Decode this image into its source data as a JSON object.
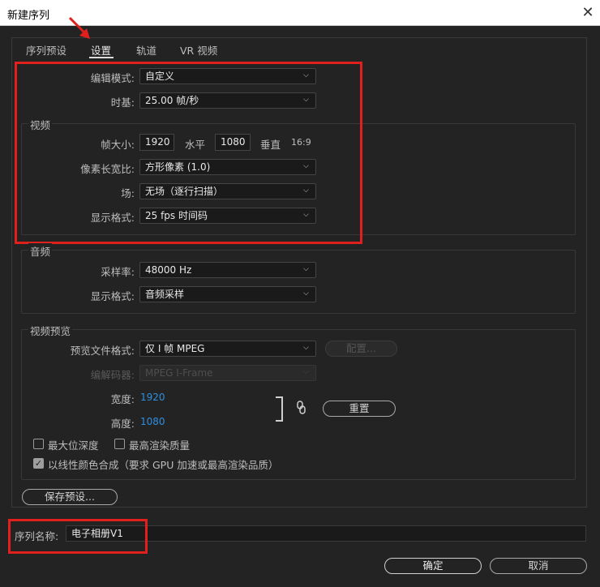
{
  "window": {
    "title": "新建序列",
    "close_glyph": "✕"
  },
  "tabs": [
    {
      "label": "序列预设"
    },
    {
      "label": "设置",
      "active": true
    },
    {
      "label": "轨道"
    },
    {
      "label": "VR 视频"
    }
  ],
  "settings": {
    "edit_mode": {
      "label": "编辑模式:",
      "value": "自定义"
    },
    "timebase": {
      "label": "时基:",
      "value": "25.00  帧/秒"
    }
  },
  "video": {
    "title": "视频",
    "frame_size": {
      "label": "帧大小:",
      "width": "1920",
      "h_label": "水平",
      "height": "1080",
      "v_label": "垂直",
      "aspect": "16:9"
    },
    "pixel_aspect": {
      "label": "像素长宽比:",
      "value": "方形像素 (1.0)"
    },
    "fields": {
      "label": "场:",
      "value": "无场（逐行扫描）"
    },
    "display_format": {
      "label": "显示格式:",
      "value": "25 fps 时间码"
    }
  },
  "audio": {
    "title": "音频",
    "sample_rate": {
      "label": "采样率:",
      "value": "48000 Hz"
    },
    "display_format": {
      "label": "显示格式:",
      "value": "音频采样"
    }
  },
  "preview": {
    "title": "视频预览",
    "file_format": {
      "label": "预览文件格式:",
      "value": "仅 I 帧 MPEG"
    },
    "configure_button": "配置...",
    "codec": {
      "label": "编解码器:",
      "value": "MPEG I-Frame"
    },
    "width": {
      "label": "宽度:",
      "value": "1920"
    },
    "height": {
      "label": "高度:",
      "value": "1080"
    },
    "reset_button": "重置",
    "max_bit_depth": {
      "label": "最大位深度",
      "checked": false
    },
    "max_render_quality": {
      "label": "最高渲染质量",
      "checked": false
    },
    "linear_color": {
      "label": "以线性颜色合成（要求 GPU 加速或最高渲染品质）",
      "checked": true
    }
  },
  "save_preset_button": "保存预设...",
  "sequence_name": {
    "label": "序列名称:",
    "value": "电子相册V1"
  },
  "buttons": {
    "ok": "确定",
    "cancel": "取消"
  },
  "colors": {
    "annotation_red": "#e0201c",
    "link_blue": "#2e8fe0",
    "background": "#232323"
  },
  "icons": {
    "dropdown": "chevron-down-icon",
    "link": "chain-link-icon",
    "annotation": "red-arrow-icon"
  }
}
